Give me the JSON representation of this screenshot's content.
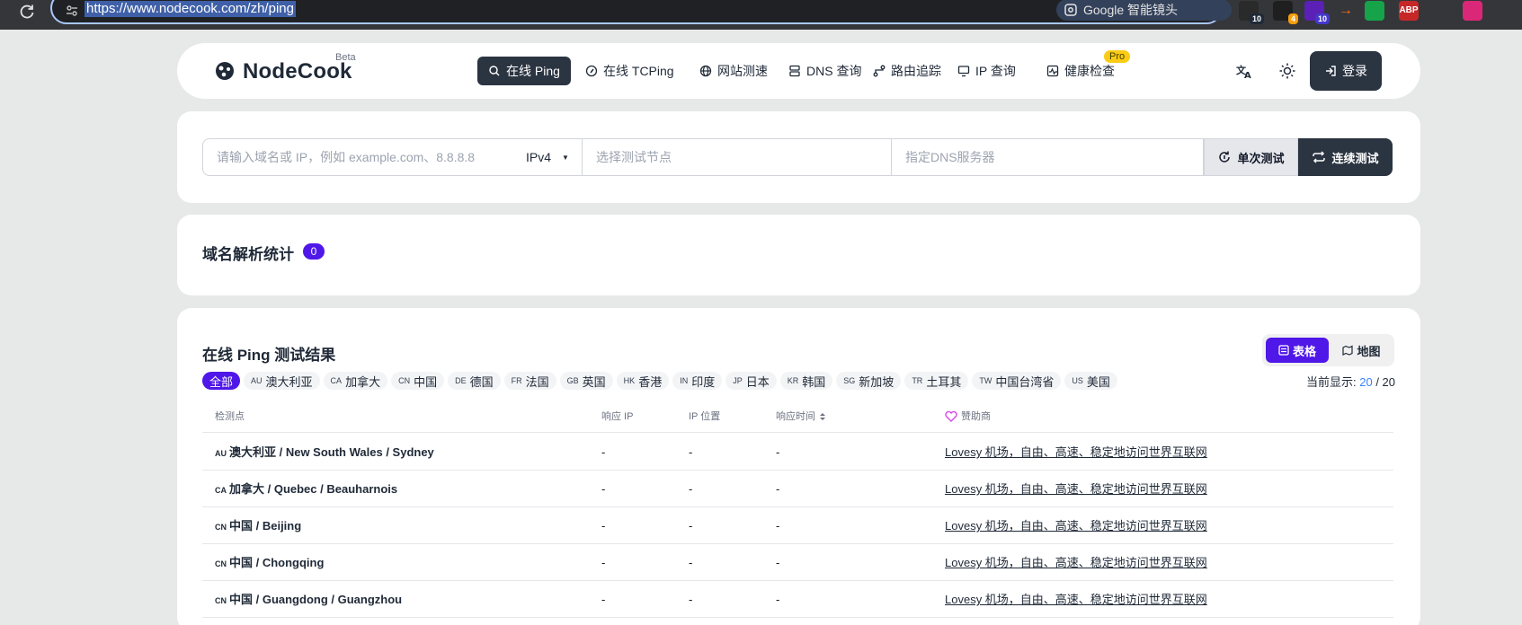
{
  "browser": {
    "url": "https://www.nodecook.com/zh/ping",
    "lens_label": "Google 智能镜头",
    "extensions": [
      {
        "name": "ext-1",
        "badge": "10",
        "color": "#2a2a2a",
        "badge_color": "#1f2937"
      },
      {
        "name": "ext-2",
        "badge": "4",
        "color": "#1f1f1f",
        "badge_color": "#f59e0b"
      },
      {
        "name": "ext-3",
        "badge": "10",
        "color": "#5b21b6",
        "badge_color": "#4338ca"
      },
      {
        "name": "ext-arrow",
        "label": "→",
        "color": "#35363a"
      },
      {
        "name": "ext-4",
        "color": "#16a34a"
      },
      {
        "name": "ext-abp",
        "label": "ABP",
        "color": "#c62828"
      },
      {
        "name": "ext-5",
        "color": "#35363a"
      },
      {
        "name": "ext-6",
        "color": "#db2777"
      }
    ]
  },
  "header": {
    "logo": "NodeCook",
    "beta": "Beta",
    "nav": [
      {
        "label": "在线 Ping",
        "icon": "ping-icon",
        "active": true
      },
      {
        "label": "在线 TCPing",
        "icon": "compass-icon"
      },
      {
        "label": "网站测速",
        "icon": "globe-icon"
      },
      {
        "label": "DNS 查询",
        "icon": "server-icon"
      },
      {
        "label": "路由追踪",
        "icon": "route-icon"
      },
      {
        "label": "IP 查询",
        "icon": "monitor-icon"
      },
      {
        "label": "健康检查",
        "icon": "health-icon"
      }
    ],
    "pro_badge": "Pro",
    "login": "登录"
  },
  "search": {
    "host_placeholder": "请输入域名或 IP，例如 example.com、8.8.8.8",
    "ip_version": "IPv4",
    "node_placeholder": "选择测试节点",
    "dns_placeholder": "指定DNS服务器",
    "single_button": "单次测试",
    "continuous_button": "连续测试"
  },
  "stats": {
    "title": "域名解析统计",
    "count": "0"
  },
  "results": {
    "title": "在线 Ping 测试结果",
    "view_table": "表格",
    "view_map": "地图",
    "filters": [
      {
        "code": "",
        "label": "全部",
        "active": true
      },
      {
        "code": "AU",
        "label": "澳大利亚"
      },
      {
        "code": "CA",
        "label": "加拿大"
      },
      {
        "code": "CN",
        "label": "中国"
      },
      {
        "code": "DE",
        "label": "德国"
      },
      {
        "code": "FR",
        "label": "法国"
      },
      {
        "code": "GB",
        "label": "英国"
      },
      {
        "code": "HK",
        "label": "香港"
      },
      {
        "code": "IN",
        "label": "印度"
      },
      {
        "code": "JP",
        "label": "日本"
      },
      {
        "code": "KR",
        "label": "韩国"
      },
      {
        "code": "SG",
        "label": "新加坡"
      },
      {
        "code": "TR",
        "label": "土耳其"
      },
      {
        "code": "TW",
        "label": "中国台湾省"
      },
      {
        "code": "US",
        "label": "美国"
      }
    ],
    "showing_label": "当前显示:",
    "showing_count": "20",
    "showing_total": "/ 20",
    "columns": {
      "node": "检测点",
      "ip": "响应 IP",
      "ip_location": "IP 位置",
      "time": "响应时间",
      "sponsor": "赞助商"
    },
    "rows": [
      {
        "code": "AU",
        "location": "澳大利亚 / New South Wales / Sydney",
        "ip": "-",
        "ip_location": "-",
        "time": "-",
        "sponsor": "Lovesy 机场，自由、高速、稳定地访问世界互联网"
      },
      {
        "code": "CA",
        "location": "加拿大 / Quebec / Beauharnois",
        "ip": "-",
        "ip_location": "-",
        "time": "-",
        "sponsor": "Lovesy 机场，自由、高速、稳定地访问世界互联网"
      },
      {
        "code": "CN",
        "location": "中国 / Beijing",
        "ip": "-",
        "ip_location": "-",
        "time": "-",
        "sponsor": "Lovesy 机场，自由、高速、稳定地访问世界互联网"
      },
      {
        "code": "CN",
        "location": "中国 / Chongqing",
        "ip": "-",
        "ip_location": "-",
        "time": "-",
        "sponsor": "Lovesy 机场，自由、高速、稳定地访问世界互联网"
      },
      {
        "code": "CN",
        "location": "中国 / Guangdong / Guangzhou",
        "ip": "-",
        "ip_location": "-",
        "time": "-",
        "sponsor": "Lovesy 机场，自由、高速、稳定地访问世界互联网"
      }
    ]
  }
}
